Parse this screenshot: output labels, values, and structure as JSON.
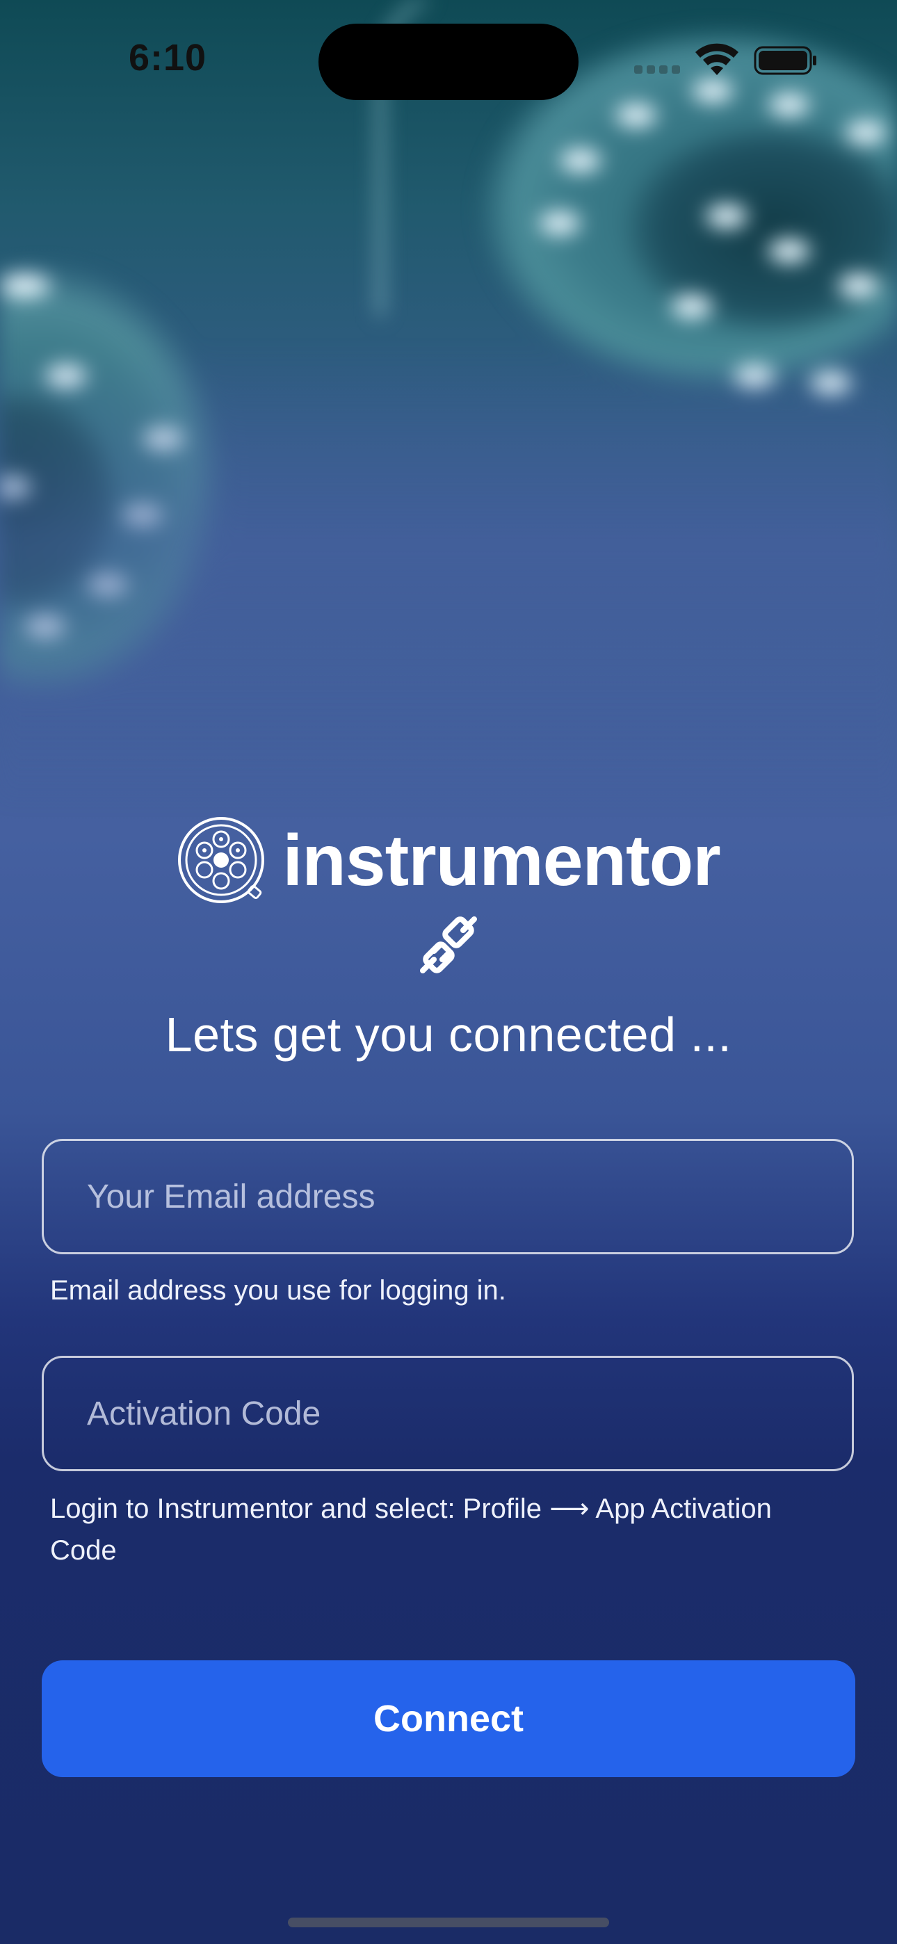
{
  "status_bar": {
    "time": "6:10",
    "icons": [
      "cellular-signal-icon",
      "wifi-icon",
      "battery-icon"
    ]
  },
  "brand": {
    "logo_icon": "instrument-tray-icon",
    "name": "instrumentor"
  },
  "connect_icon": "plug-icon",
  "headline": "Lets get you connected ...",
  "form": {
    "email": {
      "value": "",
      "placeholder": "Your Email address",
      "helper": "Email address you use for logging in."
    },
    "activation_code": {
      "value": "",
      "placeholder": "Activation Code",
      "helper": "Login to Instrumentor and select: Profile ⟶ App Activation Code"
    },
    "submit_label": "Connect"
  },
  "colors": {
    "primary_button": "#2563eb",
    "background_bottom": "#1a2b66",
    "text": "#ffffff"
  }
}
